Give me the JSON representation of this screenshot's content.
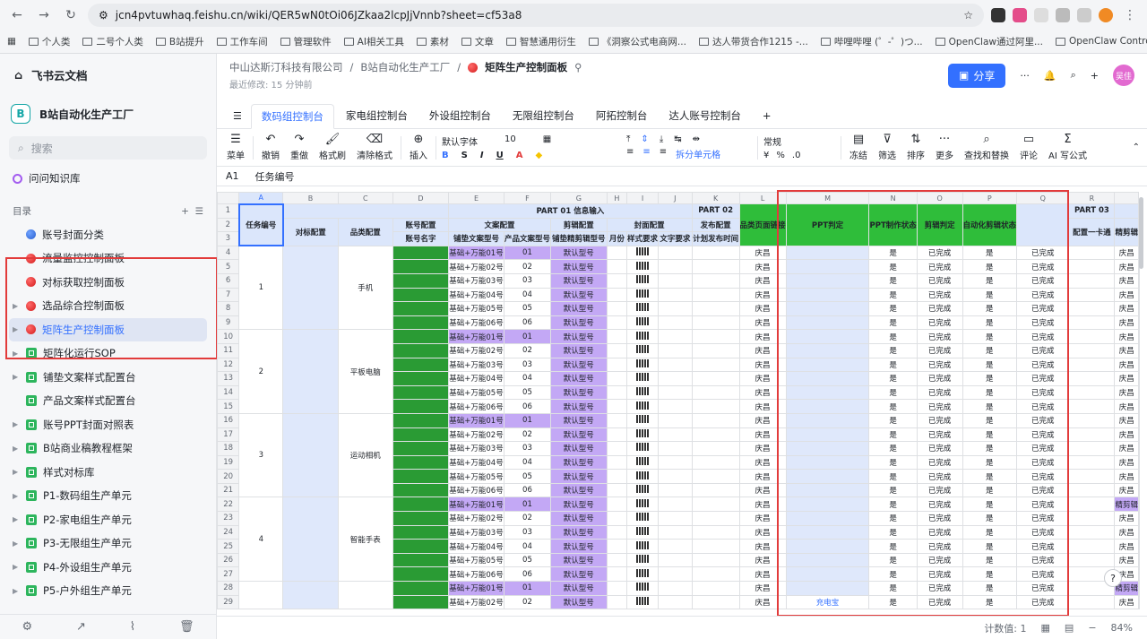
{
  "browser": {
    "url": "jcn4pvtuwhaq.feishu.cn/wiki/QER5wN0tOi06JZkaa2lcpJjVnnb?sheet=cf53a8",
    "bookmarks": [
      "个人类",
      "二号个人类",
      "B站提升",
      "工作车间",
      "管理软件",
      "AI相关工具",
      "素材",
      "文章",
      "智慧通用衍生",
      "《洞察公式电商网...",
      "达人带货合作1215 -...",
      "哔哩哔哩 (゜-゜)つ...",
      "OpenClaw通过阿里...",
      "OpenClaw Control"
    ]
  },
  "sidebar": {
    "app_name": "飞书云文档",
    "workspace": "B站自动化生产工厂",
    "workspace_letter": "B",
    "search": "搜索",
    "kb": "问问知识库",
    "section": "目录",
    "items": [
      {
        "label": "账号封面分类",
        "icon": "blue",
        "caret": false
      },
      {
        "label": "流量监控控制面板",
        "icon": "red",
        "caret": false
      },
      {
        "label": "对标获取控制面板",
        "icon": "red",
        "caret": false
      },
      {
        "label": "选品综合控制面板",
        "icon": "red",
        "caret": true
      },
      {
        "label": "矩阵生产控制面板",
        "icon": "red",
        "caret": true,
        "active": true
      },
      {
        "label": "矩阵化运行SOP",
        "icon": "sheet",
        "caret": true
      },
      {
        "label": "铺垫文案样式配置台",
        "icon": "sheet",
        "caret": true
      },
      {
        "label": "产品文案样式配置台",
        "icon": "sheet",
        "caret": false
      },
      {
        "label": "账号PPT封面对照表",
        "icon": "sheet",
        "caret": true
      },
      {
        "label": "B站商业稿教程框架",
        "icon": "sheet",
        "caret": true
      },
      {
        "label": "样式对标库",
        "icon": "sheet",
        "caret": true
      },
      {
        "label": "P1-数码组生产单元",
        "icon": "sheet",
        "caret": true
      },
      {
        "label": "P2-家电组生产单元",
        "icon": "sheet",
        "caret": true
      },
      {
        "label": "P3-无限组生产单元",
        "icon": "sheet",
        "caret": true
      },
      {
        "label": "P4-外设组生产单元",
        "icon": "sheet",
        "caret": true
      },
      {
        "label": "P5-户外组生产单元",
        "icon": "sheet",
        "caret": true
      }
    ]
  },
  "doc": {
    "crumb1": "中山达斯汀科技有限公司",
    "crumb2": "B站自动化生产工厂",
    "title": "矩阵生产控制面板",
    "edited": "最近修改: 15 分钟前",
    "share": "分享",
    "avatar": "吴佳"
  },
  "tabs": [
    "数码组控制台",
    "家电组控制台",
    "外设组控制台",
    "无限组控制台",
    "阿拓控制台",
    "达人账号控制台"
  ],
  "toolbar": {
    "menu": "菜单",
    "undo": "撤销",
    "redo": "重做",
    "painter": "格式刷",
    "clear": "清除格式",
    "insert": "插入",
    "font": "默认字体",
    "size": "10",
    "split": "拆分单元格",
    "numfmt": "常规",
    "freeze": "冻结",
    "filter": "筛选",
    "sort": "排序",
    "more": "更多",
    "find": "查找和替换",
    "comment": "评论",
    "ai": "AI 写公式"
  },
  "formula": {
    "cell": "A1",
    "value": "任务编号"
  },
  "grid": {
    "cols": [
      "A",
      "B",
      "C",
      "D",
      "E",
      "F",
      "G",
      "H",
      "I",
      "J",
      "K",
      "L",
      "M",
      "N",
      "O",
      "P",
      "Q",
      "R"
    ],
    "part1": "PART 01 信息输入",
    "part2": "PART 02",
    "part3": "PART 03",
    "h_task": "任务编号",
    "h_bench": "对标配置",
    "h_cat": "品类配置",
    "h_acct": "账号配置",
    "h_acctname": "账号名字",
    "h_copy": "文案配置",
    "h_copymodel": "铺垫文案型号",
    "h_prodcopy": "产品文案型号",
    "h_edit": "剪辑配置",
    "h_editmodel": "铺垫精剪辑型号",
    "h_cover": "封面配置",
    "h_month": "月份",
    "h_style": "样式要求",
    "h_text": "文字要求",
    "h_pub": "发布配置",
    "h_plan": "计划发布时间",
    "h_cfg": "配置一卡通",
    "h_link": "品类页面链接",
    "h_ppt": "PPT判定",
    "h_pptstat": "PPT制作状态",
    "h_cut": "剪辑判定",
    "h_auto": "自动化剪辑状态",
    "h_fine": "精剪辑",
    "groups": [
      {
        "id": "1",
        "cat": "手机"
      },
      {
        "id": "2",
        "cat": "平板电脑"
      },
      {
        "id": "3",
        "cat": "运动相机"
      },
      {
        "id": "4",
        "cat": "智能手表"
      }
    ],
    "copy_prefix": "基础+万能",
    "copy_suffix": "号",
    "default_model": "默认型号",
    "city": "庆昌",
    "yes": "是",
    "done": "已完成",
    "row29_link": "充电宝",
    "fine_label": "精剪辑",
    "fine_plain": "庆昌"
  },
  "status": {
    "count": "计数值: 1",
    "zoom": "84%"
  }
}
